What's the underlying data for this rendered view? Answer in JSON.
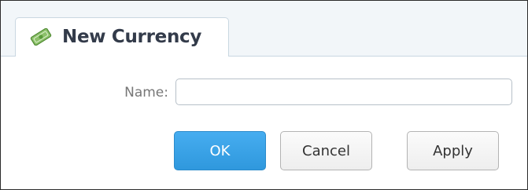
{
  "dialog": {
    "tab_title": "New Currency",
    "tab_icon": "money-icon"
  },
  "form": {
    "name_label": "Name:",
    "name_value": "",
    "name_placeholder": ""
  },
  "buttons": {
    "ok": "OK",
    "cancel": "Cancel",
    "apply": "Apply"
  },
  "colors": {
    "primary_button": "#3aa3e8",
    "tab_border": "#c9d7e1",
    "icon_green": "#5a9c3a"
  }
}
